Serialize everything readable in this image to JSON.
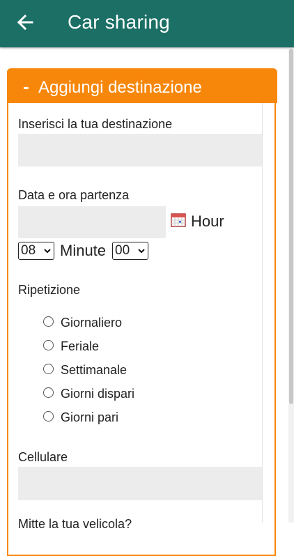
{
  "appbar": {
    "title": "Car sharing",
    "back_icon": "arrow-left-icon",
    "color": "#1b6f65"
  },
  "panel": {
    "toggle": "-",
    "title": "Aggiungi destinazione",
    "accent": "#f7870b"
  },
  "form": {
    "destination_label": "Inserisci la tua destinazione",
    "destination_value": "",
    "datetime_label": "Data e ora partenza",
    "date_value": "",
    "hour_label": "Hour",
    "hour_value": "08",
    "minute_label": "Minute",
    "minute_value": "00",
    "repeat_label": "Ripetizione",
    "repeat_options": [
      "Giornaliero",
      "Feriale",
      "Settimanale",
      "Giorni dispari",
      "Giorni pari"
    ],
    "phone_label": "Cellulare",
    "phone_value": "",
    "next_label_partial": "Mitte la tua velicola?"
  }
}
